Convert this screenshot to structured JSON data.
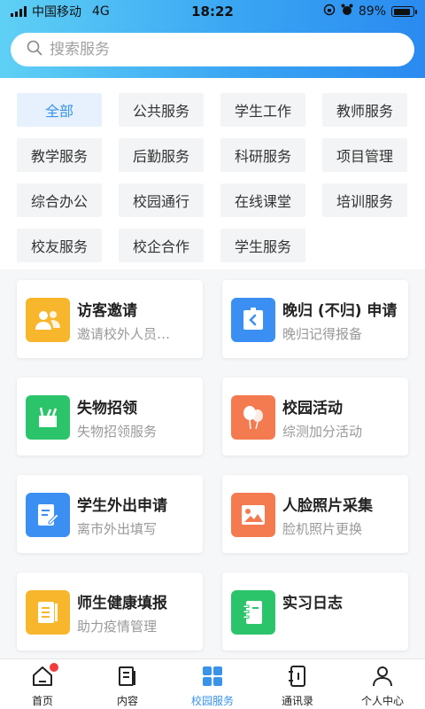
{
  "status_bar": {
    "carrier": "中国移动",
    "network": "4G",
    "time": "18:22",
    "battery": "89%",
    "battery_level": 0.89
  },
  "search": {
    "placeholder": "搜索服务"
  },
  "categories": [
    "全部",
    "公共服务",
    "学生工作",
    "教师服务",
    "教学服务",
    "后勤服务",
    "科研服务",
    "项目管理",
    "综合办公",
    "校园通行",
    "在线课堂",
    "培训服务",
    "校友服务",
    "校企合作",
    "学生服务"
  ],
  "active_category": "全部",
  "services": [
    {
      "title": "访客邀请",
      "subtitle": "邀请校外人员…",
      "icon": "visitor-icon",
      "color": "#f7b62b"
    },
    {
      "title": "晚归 (不归) 申请",
      "subtitle": "晚归记得报备",
      "icon": "return-late-icon",
      "color": "#3b8ff3"
    },
    {
      "title": "失物招领",
      "subtitle": "失物招领服务",
      "icon": "lost-found-icon",
      "color": "#2cc46b"
    },
    {
      "title": "校园活动",
      "subtitle": "综测加分活动",
      "icon": "balloon-icon",
      "color": "#f47a50"
    },
    {
      "title": "学生外出申请",
      "subtitle": "离市外出填写",
      "icon": "form-edit-icon",
      "color": "#3b8ff3"
    },
    {
      "title": "人脸照片采集",
      "subtitle": "脸机照片更换",
      "icon": "photo-icon",
      "color": "#f47a50"
    },
    {
      "title": "师生健康填报",
      "subtitle": "助力疫情管理",
      "icon": "health-report-icon",
      "color": "#f7b62b"
    },
    {
      "title": "实习日志",
      "subtitle": "",
      "icon": "notebook-icon",
      "color": "#2cc46b"
    }
  ],
  "tabs": [
    {
      "label": "首页",
      "icon": "home-icon"
    },
    {
      "label": "内容",
      "icon": "content-icon"
    },
    {
      "label": "校园服务",
      "icon": "grid-icon"
    },
    {
      "label": "通讯录",
      "icon": "contacts-icon"
    },
    {
      "label": "个人中心",
      "icon": "profile-icon"
    }
  ],
  "active_tab": "校园服务",
  "accent_color": "#3a93ea"
}
